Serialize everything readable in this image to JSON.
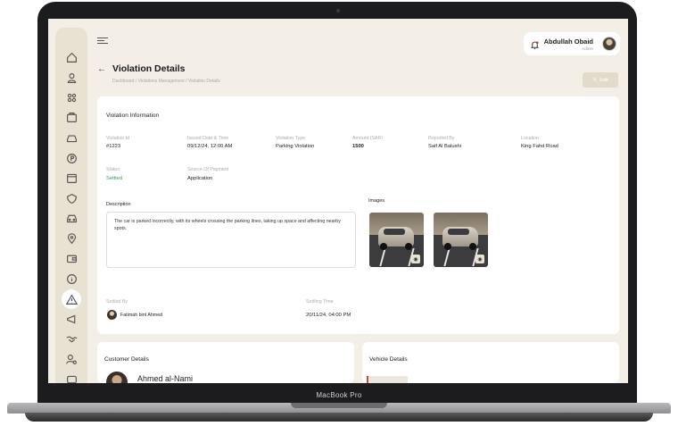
{
  "device": {
    "brand": "MacBook Pro"
  },
  "header": {
    "user_name": "Abdullah Obaid",
    "user_role": "Admin"
  },
  "page": {
    "title": "Violation Details",
    "breadcrumb": "Dashboard / Violations Management / Violation Details",
    "edit_label": "Edit"
  },
  "violation": {
    "section_title": "Violation Information",
    "fields": {
      "violation_id": {
        "label": "Violation Id",
        "value": "#1223"
      },
      "issued": {
        "label": "Issued Date & Time",
        "value": "09/12/24, 12:00 AM"
      },
      "type": {
        "label": "Violation Type",
        "value": "Parking Violation"
      },
      "amount": {
        "label": "Amount (SAR)",
        "value": "1500"
      },
      "reported_by": {
        "label": "Reported By",
        "value": "Saif Al Balushi"
      },
      "location": {
        "label": "Location",
        "value": "King Fahd Road"
      },
      "status": {
        "label": "Status",
        "value": "Settled"
      },
      "payment_source": {
        "label": "Source Of Payment",
        "value": "Application"
      }
    },
    "description_label": "Description",
    "description_text": "The car is parked incorrectly, with its wheels crossing the parking lines, taking up space and affecting nearby spots.",
    "images_label": "Images",
    "settled_by": {
      "label": "Settled By",
      "value": "Fatimah bint Ahmed"
    },
    "settling_time": {
      "label": "Settling Time",
      "value": "20/11/24, 04:00 PM"
    }
  },
  "customer": {
    "section_title": "Customer Details",
    "name": "Ahmed al-Nami"
  },
  "vehicle": {
    "section_title": "Vehicle Details"
  },
  "colors": {
    "background": "#f3efe6",
    "sidebar": "#e8e2d3",
    "status_settled": "#2e9d5b",
    "edit_button": "#e1dbcc"
  },
  "sidebar_icons": [
    "home-icon",
    "user-icon",
    "users-icon",
    "box-icon",
    "car-icon",
    "parking-icon",
    "calendar-icon",
    "shield-icon",
    "car-front-icon",
    "location-icon",
    "wallet-icon",
    "info-icon",
    "warning-icon",
    "megaphone-icon",
    "handshake-icon",
    "user-settings-icon",
    "message-icon"
  ]
}
